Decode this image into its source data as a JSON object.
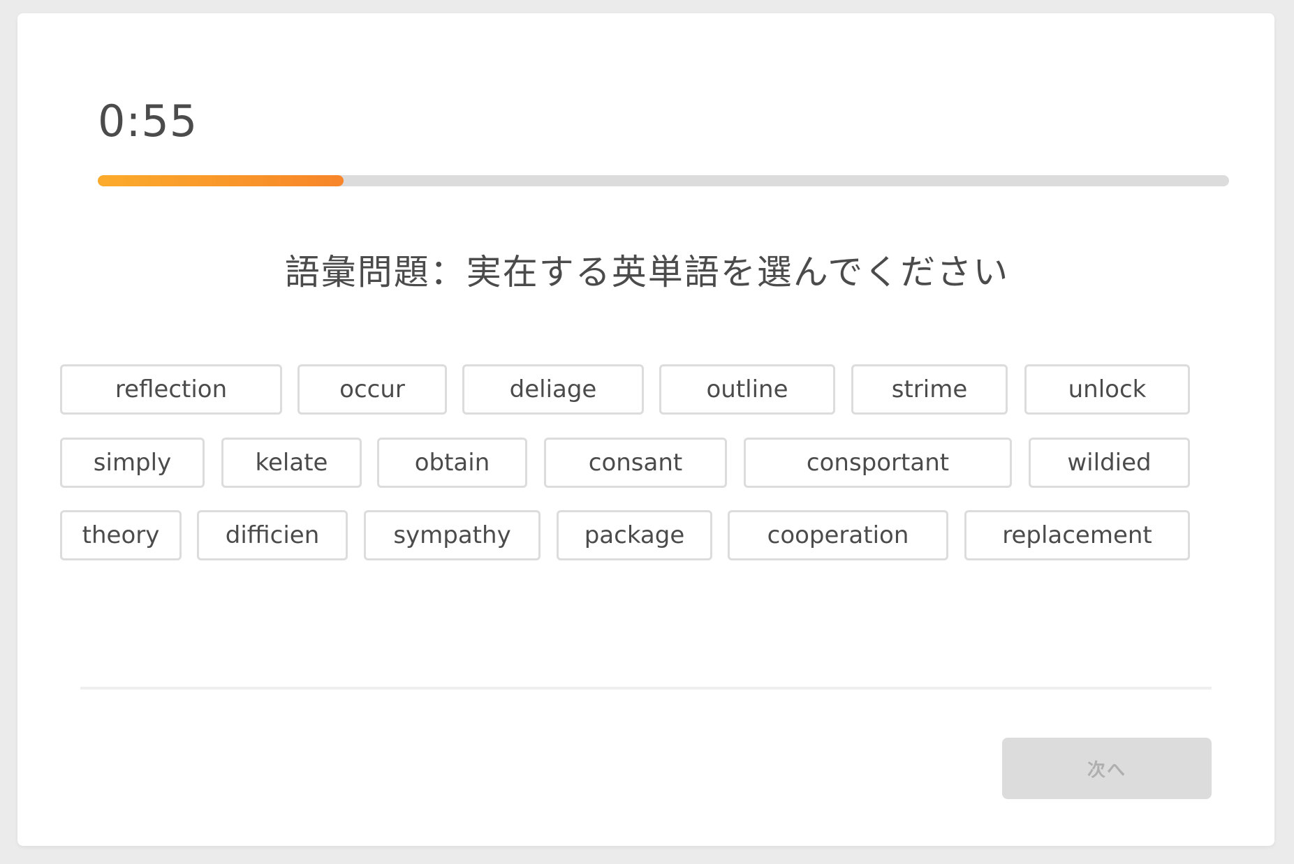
{
  "timer": "0:55",
  "progress": {
    "fraction": 0.217,
    "fill_color_start": "#fbab2b",
    "fill_color_end": "#f7852a",
    "track_color": "#dcdcdc"
  },
  "question": "語彙問題：実在する英単語を選んでください",
  "words": [
    [
      "reflection",
      "occur",
      "deliage",
      "outline",
      "strime",
      "unlock"
    ],
    [
      "simply",
      "kelate",
      "obtain",
      "consant",
      "consportant",
      "wildied"
    ],
    [
      "theory",
      "difficien",
      "sympathy",
      "package",
      "cooperation",
      "replacement"
    ]
  ],
  "next_button": {
    "label": "次へ",
    "enabled": false
  }
}
